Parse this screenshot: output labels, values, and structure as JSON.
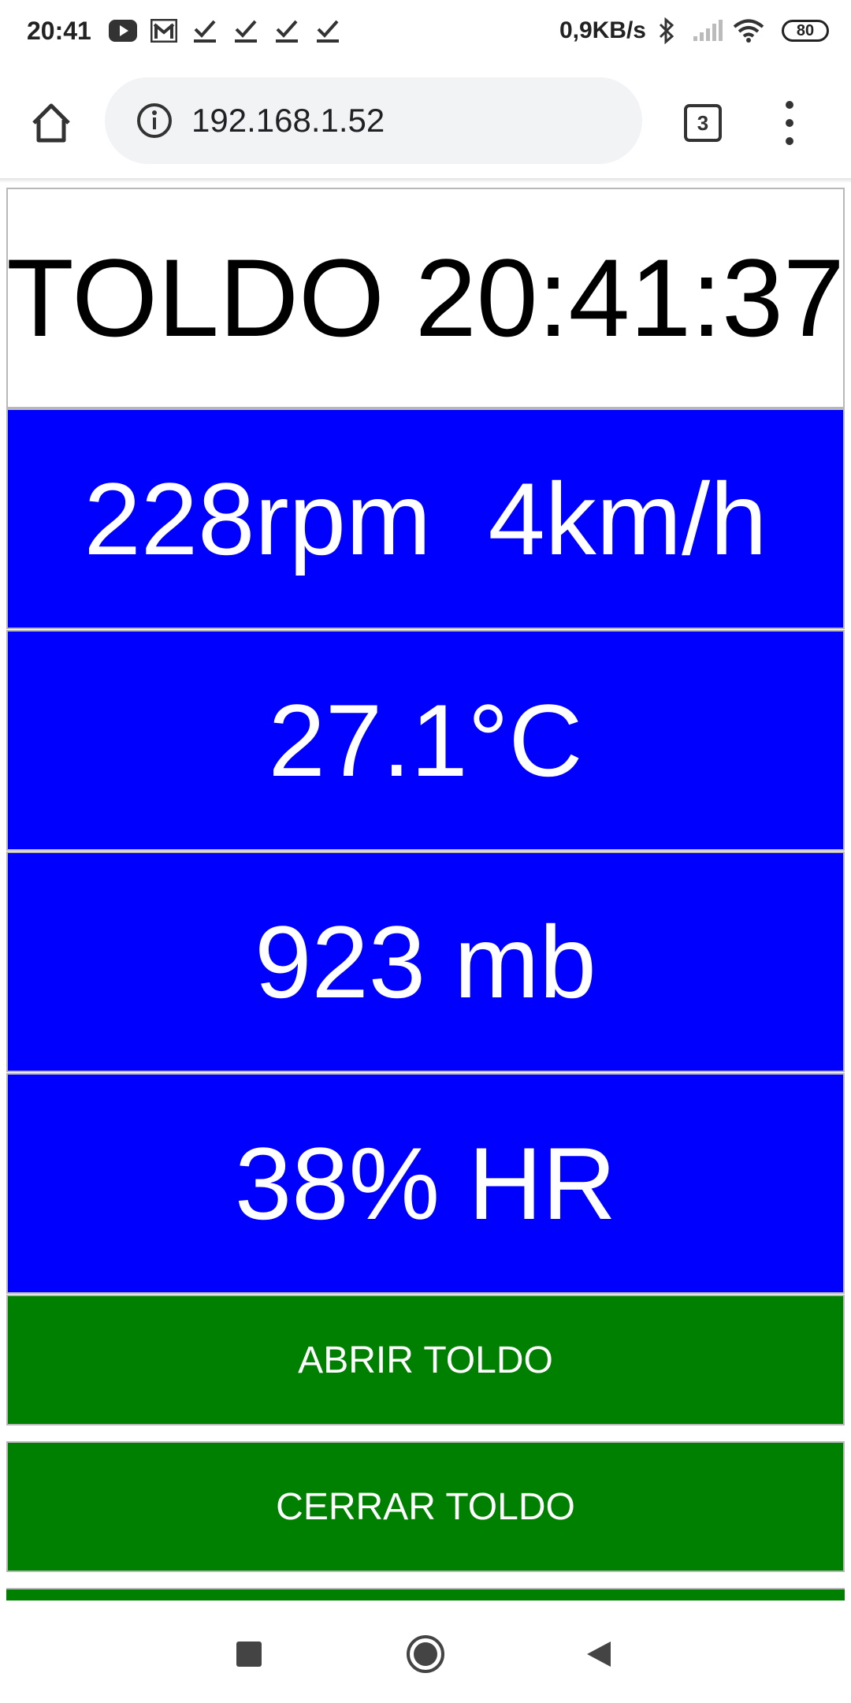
{
  "status_bar": {
    "time": "20:41",
    "icons_left": [
      "youtube-icon",
      "gmail-icon",
      "check-icon",
      "check-icon",
      "check-icon",
      "check-icon"
    ],
    "net_speed": "0,9KB/s",
    "icons_right": [
      "bluetooth-icon",
      "signal-icon",
      "wifi-icon"
    ],
    "battery": "80"
  },
  "browser": {
    "url": "192.168.1.52",
    "tab_count": "3"
  },
  "page": {
    "title": "TOLDO 20:41:37",
    "wind": "228rpm  4km/h",
    "temperature": "27.1°C",
    "pressure": "923 mb",
    "humidity": "38% HR",
    "buttons": {
      "open": "ABRIR TOLDO",
      "close": "CERRAR TOLDO"
    }
  },
  "colors": {
    "panel_bg": "#0000ff",
    "button_bg": "#008000",
    "panel_text": "#ffffff"
  }
}
